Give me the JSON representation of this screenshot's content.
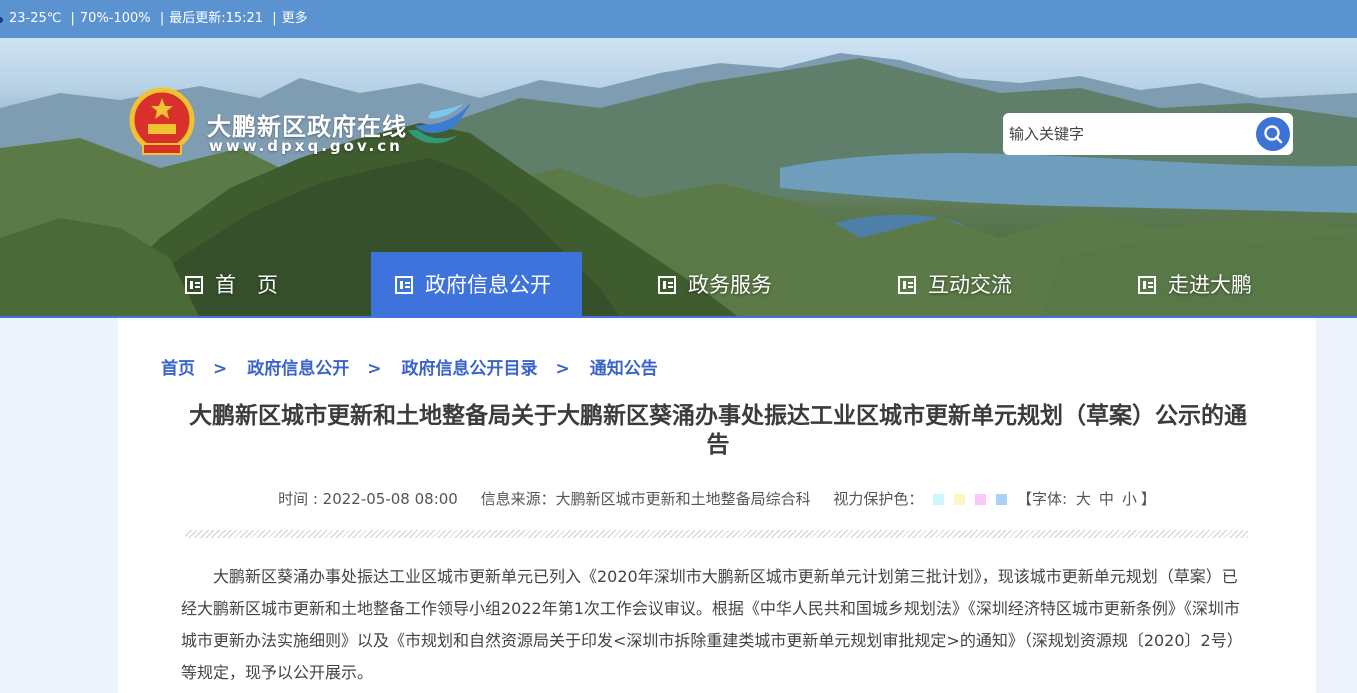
{
  "topbar": {
    "weather": "23-25℃",
    "humidity": "70%-100%",
    "updated": "最后更新:15:21",
    "more": "更多",
    "separator": "|"
  },
  "header": {
    "site_name": "大鹏新区政府在线",
    "site_url": "www.dpxq.gov.cn",
    "search_placeholder": "输入关键字"
  },
  "nav": {
    "items": [
      {
        "label": "首　页"
      },
      {
        "label": "政府信息公开"
      },
      {
        "label": "政务服务"
      },
      {
        "label": "互动交流"
      },
      {
        "label": "走进大鹏"
      }
    ]
  },
  "breadcrumb": {
    "items": [
      "首页",
      "政府信息公开",
      "政府信息公开目录",
      "通知公告"
    ],
    "separator": ">"
  },
  "article": {
    "title": "大鹏新区城市更新和土地整备局关于大鹏新区葵涌办事处振达工业区城市更新单元规划（草案）公示的通告",
    "time": "时间 : 2022-05-08 08:00",
    "source": "信息来源：大鹏新区城市更新和土地整备局综合科",
    "eye_care_label": "视力保护色：",
    "eye_care_colors": [
      "#c9f7fb",
      "#fbf6c6",
      "#f8c9f7",
      "#a9d3f7"
    ],
    "font_label": "【字体:",
    "font_sizes": [
      "大",
      "中",
      "小"
    ],
    "font_close": "】",
    "body": "大鹏新区葵涌办事处振达工业区城市更新单元已列入《2020年深圳市大鹏新区城市更新单元计划第三批计划》，现该城市更新单元规划（草案）已经大鹏新区城市更新和土地整备工作领导小组2022年第1次工作会议审议。根据《中华人民共和国城乡规划法》《深圳经济特区城市更新条例》《深圳市城市更新办法实施细则》以及《市规划和自然资源局关于印发<深圳市拆除重建类城市更新单元规划审批规定>的通知》（深规划资源规〔2020〕2号）等规定，现予以公开展示。"
  },
  "colors": {
    "topbar_bg": "#5a93cf",
    "accent": "#3e73db",
    "link": "#3a64c8"
  }
}
